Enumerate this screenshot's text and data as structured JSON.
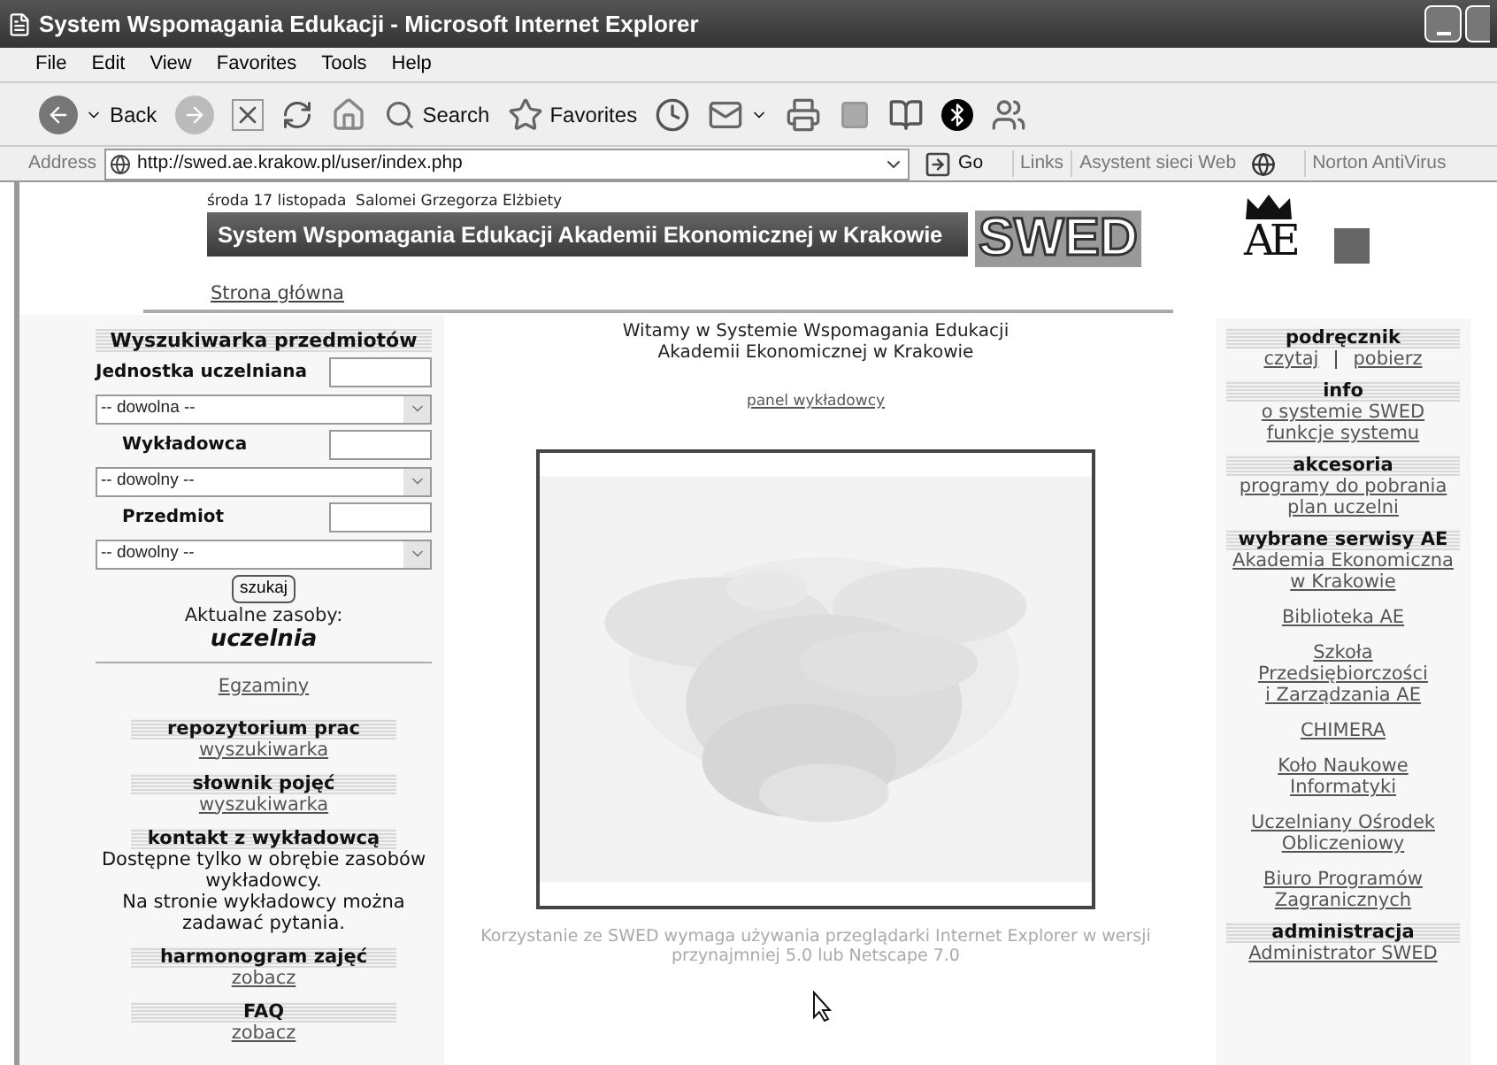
{
  "window": {
    "title": "System Wspomagania Edukacji - Microsoft Internet Explorer"
  },
  "menu": [
    "File",
    "Edit",
    "View",
    "Favorites",
    "Tools",
    "Help"
  ],
  "toolbar": {
    "back": "Back",
    "search": "Search",
    "favorites": "Favorites"
  },
  "address": {
    "label": "Address",
    "url": "http://swed.ae.krakow.pl/user/index.php",
    "go": "Go",
    "links": "Links",
    "assistant": "Asystent sieci Web",
    "antivirus": "Norton AntiVirus"
  },
  "header": {
    "date": "środa 17 listopada  Salomei Grzegorza Elżbiety",
    "banner": "System Wspomagania Edukacji Akademii Ekonomicznej w Krakowie",
    "logo": "SWED",
    "emblem": "AE",
    "home": "Strona główna"
  },
  "search_panel": {
    "heading": "Wyszukiwarka przedmiotów",
    "fields": [
      {
        "label": "Jednostka uczelniana",
        "value": "-- dowolna --"
      },
      {
        "label": "Wykładowca",
        "value": "-- dowolny --"
      },
      {
        "label": "Przedmiot",
        "value": "-- dowolny --"
      }
    ],
    "button": "szukaj",
    "resources_label": "Aktualne zasoby:",
    "resources_value": "uczelnia"
  },
  "left_link": "Egzaminy",
  "left_sections": [
    {
      "heading": "repozytorium prac",
      "entries": [
        {
          "kind": "link",
          "lines": [
            "wyszukiwarka"
          ]
        }
      ]
    },
    {
      "heading": "słownik pojęć",
      "entries": [
        {
          "kind": "link",
          "lines": [
            "wyszukiwarka"
          ]
        }
      ]
    },
    {
      "heading": "kontakt z wykładowcą",
      "entries": [
        {
          "kind": "text",
          "lines": [
            "Dostępne tylko w obrębie zasobów",
            "wykładowcy.",
            "Na stronie wykładowcy można",
            "zadawać pytania."
          ]
        }
      ]
    },
    {
      "heading": "harmonogram zajęć",
      "entries": [
        {
          "kind": "link",
          "lines": [
            "zobacz"
          ]
        }
      ]
    },
    {
      "heading": "FAQ",
      "entries": [
        {
          "kind": "link",
          "lines": [
            "zobacz"
          ]
        }
      ]
    }
  ],
  "center": {
    "welcome": [
      "Witamy w Systemie Wspomagania Edukacji",
      "Akademii Ekonomicznej w Krakowie"
    ],
    "panel_link": "panel wykładowcy",
    "picture": {
      "kind": "picture"
    },
    "note": [
      "Korzystanie ze SWED wymaga używania przeglądarki Internet Explorer w wersji",
      "przynajmniej 5.0 lub Netscape 7.0"
    ]
  },
  "right_sections": [
    {
      "heading": "podręcznik",
      "entries": [
        {
          "kind": "inline",
          "links": [
            "czytaj",
            "pobierz"
          ],
          "separator": "|"
        }
      ]
    },
    {
      "heading": "info",
      "entries": [
        {
          "kind": "link_list",
          "items": [
            "o systemie SWED",
            "funkcje systemu"
          ]
        }
      ]
    },
    {
      "heading": "akcesoria",
      "entries": [
        {
          "kind": "link_list",
          "items": [
            "programy do pobrania",
            "plan uczelni"
          ]
        }
      ]
    },
    {
      "heading": "wybrane serwisy AE",
      "entries": [
        {
          "kind": "link",
          "lines": [
            "Akademia Ekonomiczna",
            "w Krakowie"
          ]
        },
        {
          "kind": "link",
          "lines": [
            "Biblioteka AE"
          ]
        },
        {
          "kind": "link",
          "lines": [
            "Szkoła",
            "Przedsiębiorczości",
            "i Zarządzania AE"
          ]
        },
        {
          "kind": "link",
          "lines": [
            "CHIMERA"
          ]
        },
        {
          "kind": "link",
          "lines": [
            "Koło Naukowe",
            "Informatyki"
          ]
        },
        {
          "kind": "link",
          "lines": [
            "Uczelniany Ośrodek",
            "Obliczeniowy"
          ]
        },
        {
          "kind": "link",
          "lines": [
            "Biuro Programów",
            "Zagranicznych"
          ]
        }
      ]
    },
    {
      "heading": "administracja",
      "entries": [
        {
          "kind": "link",
          "lines": [
            "Administrator SWED"
          ]
        }
      ]
    }
  ]
}
